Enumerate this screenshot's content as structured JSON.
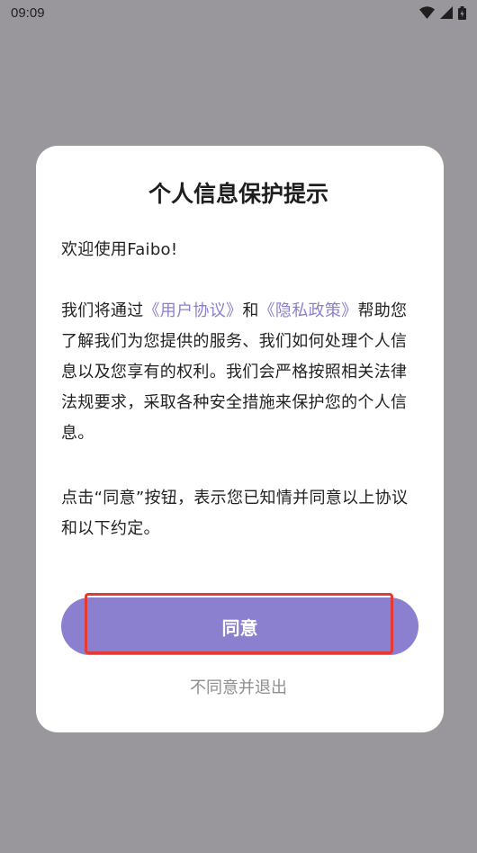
{
  "status_bar": {
    "time": "09:09",
    "icons": [
      "wifi-icon",
      "signal-icon",
      "battery-icon"
    ]
  },
  "dialog": {
    "title": "个人信息保护提示",
    "welcome": "欢迎使用Faibo!",
    "policy_pre": "我们将通过",
    "user_agreement_link": "《用户协议》",
    "policy_and": "和",
    "privacy_policy_link": "《隐私政策》",
    "policy_post": "帮助您了解我们为您提供的服务、我们如何处理个人信息以及您享有的权利。我们会严格按照相关法律法规要求，采取各种安全措施来保护您的个人信息。",
    "agree_notice": "点击“同意”按钮，表示您已知情并同意以上协议和以下约定。",
    "agree_button": "同意",
    "decline_button": "不同意并退出"
  },
  "colors": {
    "accent": "#8b7fcf",
    "overlay": "#99979c",
    "highlight": "#e53935"
  }
}
